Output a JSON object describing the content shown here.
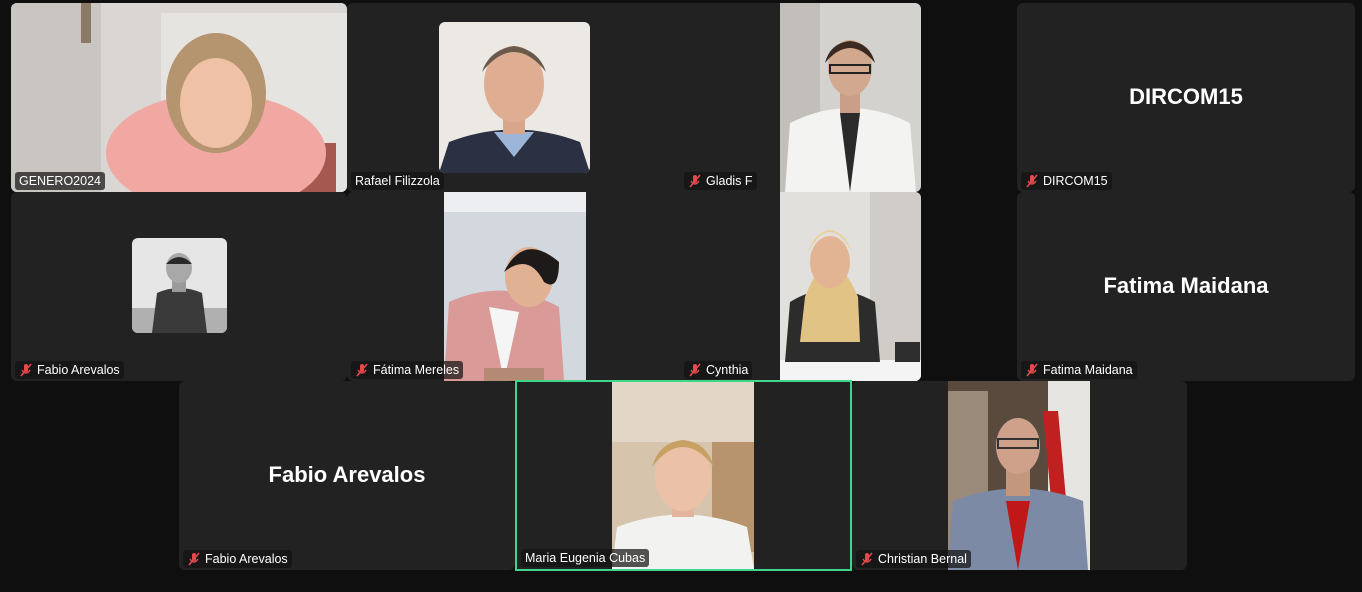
{
  "colors": {
    "active_speaker_border": "#3fd68a",
    "tile_bg": "#222222",
    "muted_icon": "#e5484d"
  },
  "participants": [
    {
      "name": "GENERO2024",
      "muted": false,
      "video": true
    },
    {
      "name": "Rafael Filizzola",
      "muted": false,
      "video": false,
      "avatar": "profile-photo"
    },
    {
      "name": "Gladis F",
      "muted": true,
      "video": true
    },
    {
      "name": "DIRCOM15",
      "muted": true,
      "video": false,
      "display_name": "DIRCOM15"
    },
    {
      "name": "Fabio Arevalos",
      "muted": true,
      "video": false,
      "avatar": "profile-photo"
    },
    {
      "name": "Fátima Mereles",
      "muted": true,
      "video": true
    },
    {
      "name": "Cynthia",
      "muted": true,
      "video": true
    },
    {
      "name": "Fatima Maidana",
      "muted": true,
      "video": false,
      "display_name": "Fatima Maidana"
    },
    {
      "name": "Fabio Arevalos",
      "muted": true,
      "video": false,
      "display_name": "Fabio Arevalos"
    },
    {
      "name": "Maria Eugenia Cubas",
      "muted": false,
      "video": true,
      "active_speaker": true
    },
    {
      "name": "Christian Bernal",
      "muted": true,
      "video": true
    }
  ]
}
